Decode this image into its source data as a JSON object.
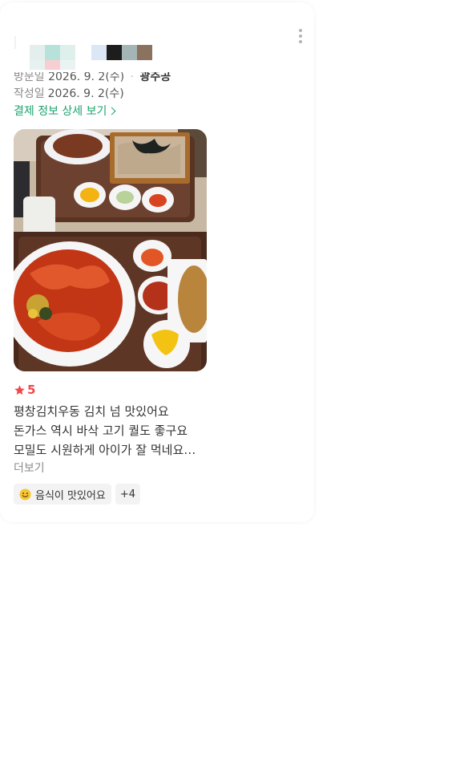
{
  "visit": {
    "label": "방문일",
    "date": "2026. 9. 2(수)",
    "separator": "·",
    "place": "광주공"
  },
  "written": {
    "label": "작성일",
    "date": "2026. 9. 2(수)"
  },
  "payment_link": "결제 정보 상세 보기",
  "rating": {
    "value": "5",
    "color": "#f2484a"
  },
  "review": {
    "lines": [
      "평창김치우동 김치 넘 맛있어요",
      "돈가스 역시 바삭 고기 퀄도 좋구요",
      "모밀도 시원하게 아이가 잘 먹네요…"
    ],
    "more": "더보기"
  },
  "tags": {
    "main": "음식이 맛있어요",
    "main_icon": "smiling-face-icon",
    "extra": "+4"
  },
  "colors": {
    "accent_green": "#1aa36b",
    "star_red": "#f2484a"
  }
}
